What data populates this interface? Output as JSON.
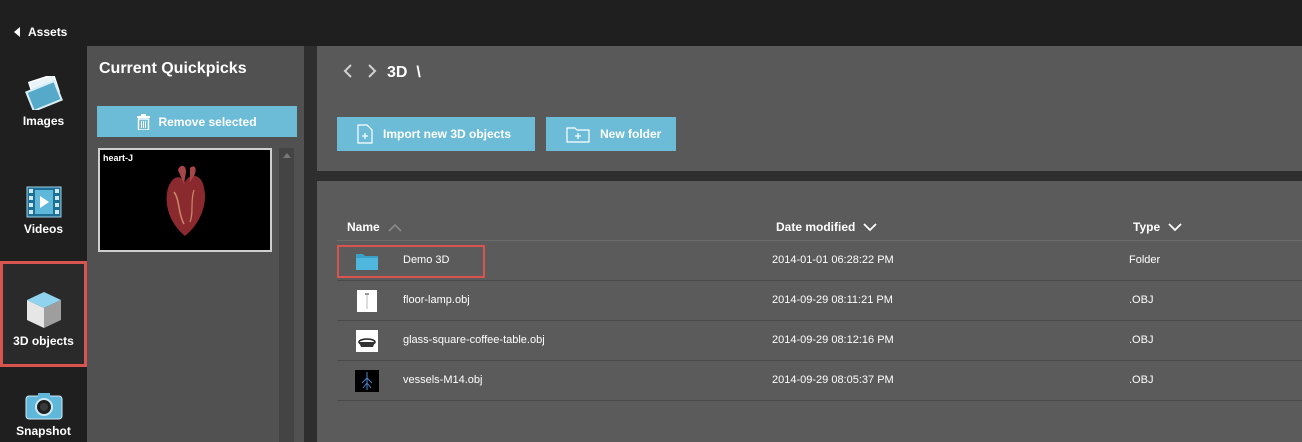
{
  "nav": {
    "back_label": "Assets",
    "items": [
      {
        "label": "Images",
        "icon": "images-icon"
      },
      {
        "label": "Videos",
        "icon": "videos-icon"
      },
      {
        "label": "3D objects",
        "icon": "cube-icon",
        "selected": true
      },
      {
        "label": "Snapshot",
        "icon": "camera-icon"
      }
    ]
  },
  "quickpicks": {
    "title": "Current Quickpicks",
    "remove_label": "Remove selected",
    "items": [
      {
        "label": "heart-J"
      }
    ]
  },
  "header": {
    "crumb": "3D  \\",
    "import_label": "Import new 3D objects",
    "new_folder_label": "New folder"
  },
  "table": {
    "columns": [
      "Name",
      "Date modified",
      "Type"
    ],
    "rows": [
      {
        "name": "Demo 3D",
        "date": "2014-01-01 06:28:22 PM",
        "type": "Folder",
        "icon": "folder-icon",
        "selected": true
      },
      {
        "name": "floor-lamp.obj",
        "date": "2014-09-29 08:11:21 PM",
        "type": ".OBJ",
        "icon": "lamp-thumbnail-icon"
      },
      {
        "name": "glass-square-coffee-table.obj",
        "date": "2014-09-29 08:12:16 PM",
        "type": ".OBJ",
        "icon": "table-thumbnail-icon"
      },
      {
        "name": "vessels-M14.obj",
        "date": "2014-09-29 08:05:37 PM",
        "type": ".OBJ",
        "icon": "vessels-thumbnail-icon"
      }
    ]
  },
  "colors": {
    "accent": "#6cbcd7",
    "highlight": "#d9534f"
  }
}
